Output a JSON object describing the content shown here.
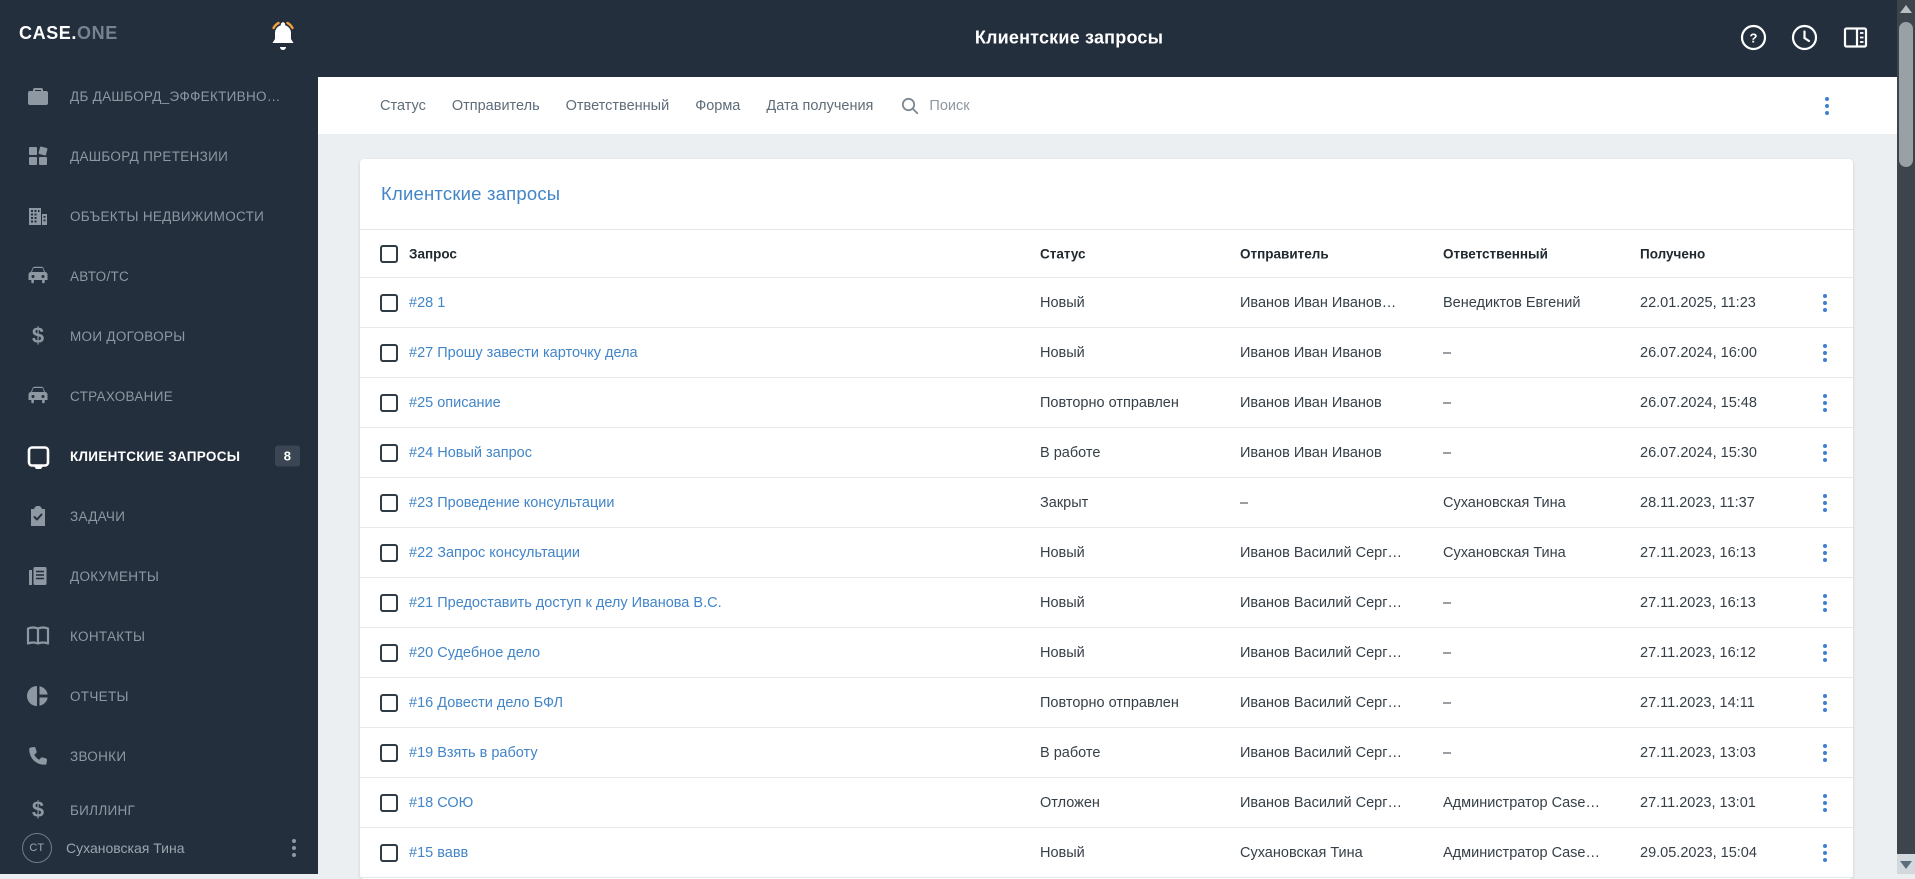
{
  "colors": {
    "dark_bg": "#232f3d",
    "sidebar_text": "#8d98a2",
    "active_text": "#ffffff",
    "badge_bg": "#3a4653",
    "content_bg": "#eceff1",
    "accent_blue": "#4285c8",
    "kebab_blue": "#3f7fd0",
    "bell_accent_orange": "#f0a03c"
  },
  "topbar": {
    "logo_primary": "CASE.",
    "logo_secondary": "ONE",
    "title": "Клиентские запросы",
    "icons": [
      "bell-icon",
      "help-icon",
      "history-clock-icon",
      "layout-panel-icon"
    ]
  },
  "sidebar": {
    "items": [
      {
        "label": "ДБ ДАШБОРД_ЭФФЕКТИВНО…",
        "icon": "briefcase-icon"
      },
      {
        "label": "ДАШБОРД ПРЕТЕНЗИИ",
        "icon": "dashboard-icon"
      },
      {
        "label": "ОБЪЕКТЫ НЕДВИЖИМОСТИ",
        "icon": "building-icon"
      },
      {
        "label": "АВТО/ТС",
        "icon": "car-icon"
      },
      {
        "label": "МОИ ДОГОВОРЫ",
        "icon": "dollar-icon"
      },
      {
        "label": "СТРАХОВАНИЕ",
        "icon": "car-icon"
      },
      {
        "label": "КЛИЕНТСКИЕ ЗАПРОСЫ",
        "icon": "inbox-icon",
        "badge": "8",
        "active": true
      },
      {
        "label": "ЗАДАЧИ",
        "icon": "clipboard-check-icon"
      },
      {
        "label": "ДОКУМЕНТЫ",
        "icon": "documents-icon"
      },
      {
        "label": "КОНТАКТЫ",
        "icon": "open-book-icon"
      },
      {
        "label": "ОТЧЕТЫ",
        "icon": "pie-chart-icon"
      },
      {
        "label": "ЗВОНКИ",
        "icon": "phone-icon"
      },
      {
        "label": "БИЛЛИНГ",
        "icon": "dollar-icon"
      }
    ],
    "user": {
      "initials": "СТ",
      "name": "Сухановская Тина"
    }
  },
  "filterbar": {
    "filters": [
      "Статус",
      "Отправитель",
      "Ответственный",
      "Форма",
      "Дата получения"
    ],
    "search_placeholder": "Поиск"
  },
  "table": {
    "title": "Клиентские запросы",
    "columns": [
      "Запрос",
      "Статус",
      "Отправитель",
      "Ответственный",
      "Получено"
    ],
    "rows": [
      {
        "query": "#28 1",
        "status": "Новый",
        "sender": "Иванов Иван Иванов…",
        "responsible": "Венедиктов Евгений",
        "received": "22.01.2025, 11:23"
      },
      {
        "query": "#27 Прошу завести карточку дела",
        "status": "Новый",
        "sender": "Иванов Иван Иванов",
        "responsible": "–",
        "received": "26.07.2024, 16:00"
      },
      {
        "query": "#25 описание",
        "status": "Повторно отправлен",
        "sender": "Иванов Иван Иванов",
        "responsible": "–",
        "received": "26.07.2024, 15:48"
      },
      {
        "query": "#24 Новый запрос",
        "status": "В работе",
        "sender": "Иванов Иван Иванов",
        "responsible": "–",
        "received": "26.07.2024, 15:30"
      },
      {
        "query": "#23 Проведение консультации",
        "status": "Закрыт",
        "sender": "–",
        "responsible": "Сухановская Тина",
        "received": "28.11.2023, 11:37"
      },
      {
        "query": "#22 Запрос консультации",
        "status": "Новый",
        "sender": "Иванов Василий Серг…",
        "responsible": "Сухановская Тина",
        "received": "27.11.2023, 16:13"
      },
      {
        "query": "#21 Предоставить доступ к делу Иванова В.С.",
        "status": "Новый",
        "sender": "Иванов Василий Серг…",
        "responsible": "–",
        "received": "27.11.2023, 16:13"
      },
      {
        "query": "#20 Судебное дело",
        "status": "Новый",
        "sender": "Иванов Василий Серг…",
        "responsible": "–",
        "received": "27.11.2023, 16:12"
      },
      {
        "query": "#16 Довести дело БФЛ",
        "status": "Повторно отправлен",
        "sender": "Иванов Василий Серг…",
        "responsible": "–",
        "received": "27.11.2023, 14:11"
      },
      {
        "query": "#19 Взять в работу",
        "status": "В работе",
        "sender": "Иванов Василий Серг…",
        "responsible": "–",
        "received": "27.11.2023, 13:03"
      },
      {
        "query": "#18 СОЮ",
        "status": "Отложен",
        "sender": "Иванов Василий Серг…",
        "responsible": "Администратор Case…",
        "received": "27.11.2023, 13:01"
      },
      {
        "query": "#15 вавв",
        "status": "Новый",
        "sender": "Сухановская Тина",
        "responsible": "Администратор Case…",
        "received": "29.05.2023, 15:04"
      }
    ]
  }
}
